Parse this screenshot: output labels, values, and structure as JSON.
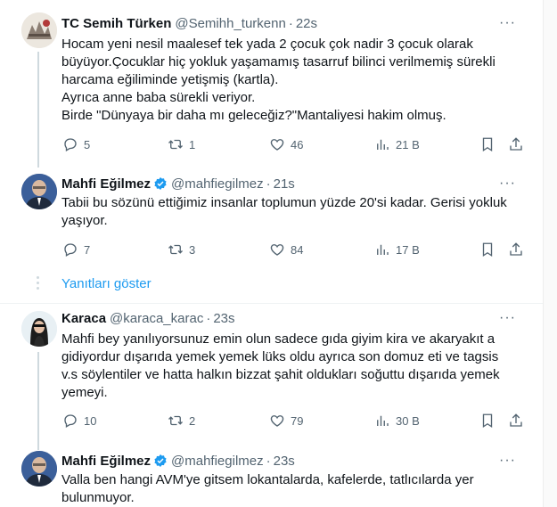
{
  "tweets": [
    {
      "name": "TC Semih Türken",
      "handle": "@Semihh_turkenn",
      "time": "22s",
      "lines": [
        "Hocam yeni nesil maalesef tek yada 2 çocuk çok nadir 3 çocuk olarak",
        "büyüyor.Çocuklar hiç yokluk yaşamamış tasarruf bilinci verilmemiş sürekli",
        "harcama eğiliminde yetişmiş (kartla).",
        "Ayrıca anne baba sürekli veriyor.",
        "Birde \"Dünyaya bir daha mı geleceğiz?\"Mantaliyesi hakim olmuş."
      ],
      "replies": "5",
      "retweets": "1",
      "likes": "46",
      "views": "21 B"
    },
    {
      "name": "Mahfi Eğilmez",
      "handle": "@mahfiegilmez",
      "time": "21s",
      "lines": [
        "Tabii bu sözünü ettiğimiz insanlar toplumun yüzde 20'si kadar. Gerisi yokluk",
        "yaşıyor."
      ],
      "replies": "7",
      "retweets": "3",
      "likes": "84",
      "views": "17 B"
    },
    {
      "name": "Karaca",
      "handle": "@karaca_karac",
      "time": "23s",
      "lines": [
        "Mahfi bey yanılıyorsunuz emin olun sadece gıda giyim kira ve akaryakıt a",
        "gidiyordur dışarıda yemek yemek lüks oldu ayrıca son domuz eti ve tagsis",
        "v.s söylentiler ve hatta halkın bizzat şahit oldukları soğuttu dışarıda yemek",
        "yemeyi."
      ],
      "replies": "10",
      "retweets": "2",
      "likes": "79",
      "views": "30 B"
    },
    {
      "name": "Mahfi Eğilmez",
      "handle": "@mahfiegilmez",
      "time": "23s",
      "lines": [
        "Valla ben hangi AVM'ye gitsem lokantalarda, kafelerde, tatlıcılarda yer",
        "bulunmuyor."
      ]
    }
  ],
  "show_replies_label": "Yanıtları göster",
  "more_label": "···",
  "colors": {
    "accent": "#1d9bf0",
    "muted": "#536471",
    "text": "#0f1419"
  }
}
